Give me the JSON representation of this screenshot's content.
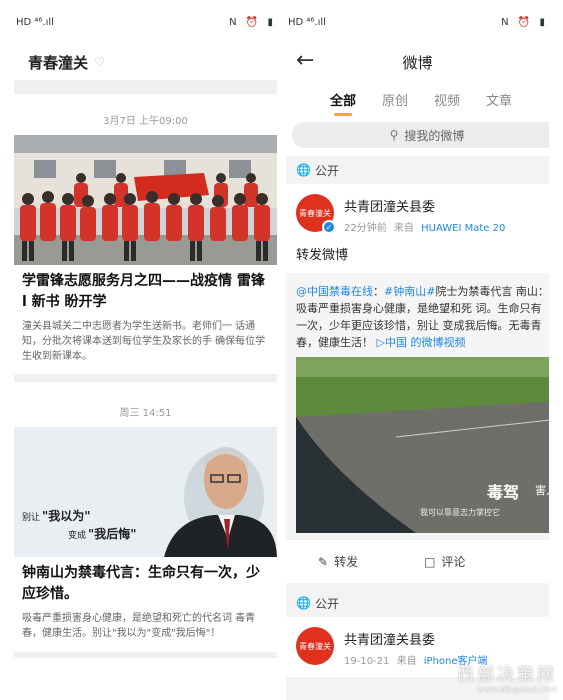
{
  "left": {
    "status": {
      "left": "HD ⁴⁶.ıll",
      "icons": [
        "N",
        "⏰",
        "▮"
      ]
    },
    "header": {
      "title": "青春潼关",
      "verify_mark": "♡"
    },
    "cards": [
      {
        "time": "3月7日 上午09:00",
        "title": "学雷锋志愿服务月之四——战疫情  雷锋l 新书  盼开学",
        "desc": "潼关县城关二中志愿者为学生送新书。老师们一 话通知，分批次将课本送到每位学生及家长的手 确保每位学生收到新课本。",
        "banner_text": "中国共产主义青年团"
      },
      {
        "time": "周三 14:51",
        "title": "钟南山为禁毒代言：生命只有一次，少 应珍惜。",
        "desc": "吸毒严重损害身心健康，是绝望和死亡的代名词 毒青春，健康生活。别让\"我以为\"变成\"我后悔\"！",
        "overlay_line1": "别让",
        "overlay_q1": "\"我以为\"",
        "overlay_line2": "变成",
        "overlay_q2": "\"我后悔\""
      }
    ]
  },
  "right": {
    "status": {
      "left": "HD ⁴⁶.ıll",
      "icons": [
        "N",
        "⏰",
        "▮"
      ]
    },
    "header": {
      "back_icon": "←",
      "title": "微博"
    },
    "tabs": [
      "全部",
      "原创",
      "视频",
      "文章"
    ],
    "search": {
      "placeholder": "搜我的微博"
    },
    "public_label": "公开",
    "post1": {
      "author": "共青团潼关县委",
      "time": "22分钟前",
      "from_prefix": "来自",
      "device": "HUAWEI Mate 20",
      "text": "转发微博",
      "repost_link": "@中国禁毒在线",
      "repost_tag": "#钟南山#",
      "repost_body": "院士为禁毒代言 南山：吸毒严重损害身心健康，是绝望和死 词。生命只有一次，少年更应该珍惜，别让 变成我后悔。无毒青春，健康生活！",
      "video_link": "中国 的微博视频",
      "video_caption": "毒驾",
      "video_caption2": "害人",
      "video_subtitle": "我可以靠意志力掌控它"
    },
    "actions": {
      "repost": "转发",
      "comment": "评论"
    },
    "post2": {
      "author": "共青团潼关县委",
      "time": "19-10-21",
      "from_prefix": "来自",
      "device": "iPhone客户端"
    },
    "avatar_text": "青春潼关"
  },
  "watermark": {
    "text": "西部决策网",
    "url": "www.xibujuece.com"
  },
  "colors": {
    "accent": "#f5a623",
    "link": "#1e88e5",
    "brand_red": "#e0301e"
  }
}
